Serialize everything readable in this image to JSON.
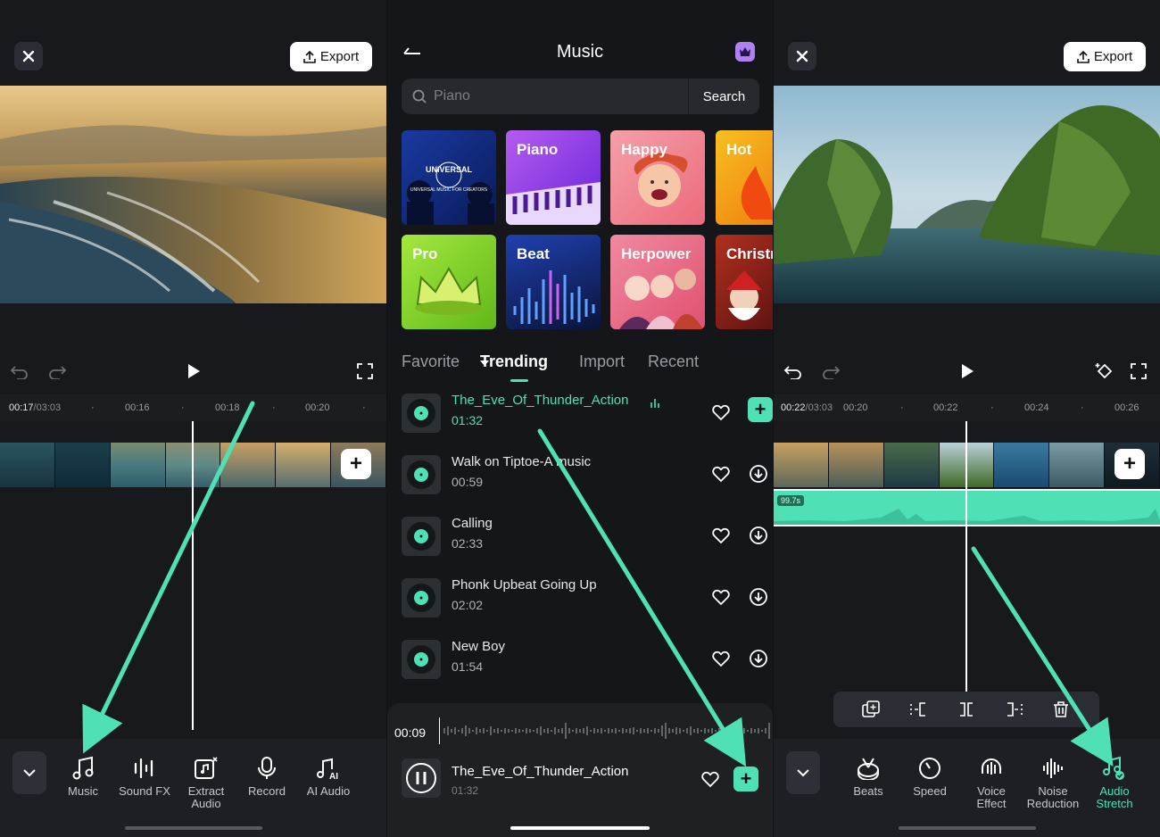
{
  "left_panel": {
    "export_label": "Export",
    "ruler": {
      "current": "00:17",
      "total": "/03:03",
      "ticks": [
        "00:16",
        "00:18",
        "00:20"
      ]
    },
    "tools": [
      {
        "label": "Music",
        "icon": "music-note-icon"
      },
      {
        "label": "Sound FX",
        "icon": "sound-fx-icon"
      },
      {
        "label": "Extract Audio",
        "icon": "extract-audio-icon"
      },
      {
        "label": "Record",
        "icon": "microphone-icon"
      },
      {
        "label": "AI Audio",
        "icon": "ai-audio-icon"
      }
    ]
  },
  "music_panel": {
    "title": "Music",
    "search_placeholder": "Piano",
    "search_button": "Search",
    "categories": [
      {
        "label": ""
      },
      {
        "label": "Piano"
      },
      {
        "label": "Happy"
      },
      {
        "label": "Hot"
      },
      {
        "label": "Pro"
      },
      {
        "label": "Beat"
      },
      {
        "label": "Herpower"
      },
      {
        "label": "Christr"
      }
    ],
    "universal_logo": {
      "main": "UNIVERSAL",
      "sub": "UNIVERSAL MUSIC FOR CREATORS"
    },
    "tabs": [
      "Favorite",
      "Trending",
      "Import",
      "Recent"
    ],
    "active_tab": "Trending",
    "songs": [
      {
        "name": "The_Eve_Of_Thunder_Action",
        "duration": "01:32",
        "playing": true
      },
      {
        "name": "Walk on Tiptoe-A music",
        "duration": "00:59"
      },
      {
        "name": "Calling",
        "duration": "02:33"
      },
      {
        "name": "Phonk Upbeat Going Up",
        "duration": "02:02"
      },
      {
        "name": "New Boy",
        "duration": "01:54"
      }
    ],
    "player": {
      "time": "00:09",
      "name": "The_Eve_Of_Thunder_Action",
      "duration": "01:32"
    }
  },
  "right_panel": {
    "export_label": "Export",
    "ruler": {
      "current": "00:22",
      "total": "/03:03",
      "ticks": [
        "00:20",
        "00:22",
        "00:24",
        "00:26"
      ]
    },
    "audio_length": "99.7s",
    "tools": [
      {
        "label": "Beats",
        "icon": "beats-icon"
      },
      {
        "label": "Speed",
        "icon": "speed-icon"
      },
      {
        "label": "Voice Effect",
        "icon": "voice-effect-icon"
      },
      {
        "label": "Noise Reduction",
        "icon": "noise-reduction-icon"
      },
      {
        "label": "Audio Stretch",
        "icon": "audio-stretch-icon",
        "active": true
      }
    ]
  },
  "colors": {
    "accent": "#4fe0b6",
    "background": "#17191d"
  }
}
